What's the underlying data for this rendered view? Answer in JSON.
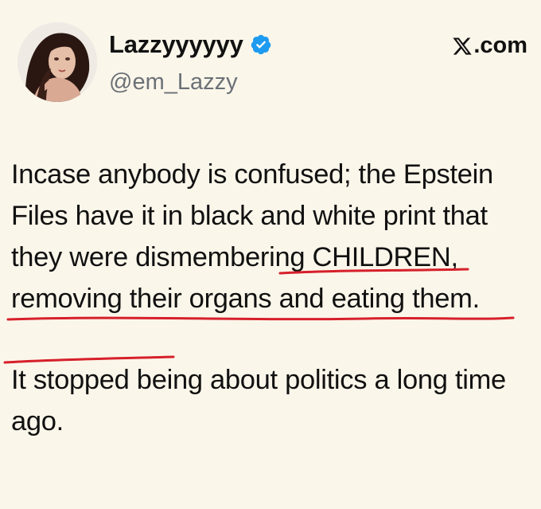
{
  "author": {
    "display_name": "Lazzyyyyyy",
    "handle": "@em_Lazzy",
    "verified_icon": "verified-badge-icon",
    "verified_color": "#1d9bf0"
  },
  "brand": {
    "logo_icon": "x-logo-icon",
    "domain": ".com"
  },
  "tweet": {
    "paragraph1": "Incase anybody is confused; the Epstein Files have it in black and white print that they were dismembering CHILDREN, removing their organs and eating them.",
    "paragraph2": "It stopped being about politics a long time ago."
  },
  "colors": {
    "background": "#fbf6ea",
    "text": "#111111",
    "handle": "#6b7177",
    "underline_annotation": "#d6202a"
  }
}
